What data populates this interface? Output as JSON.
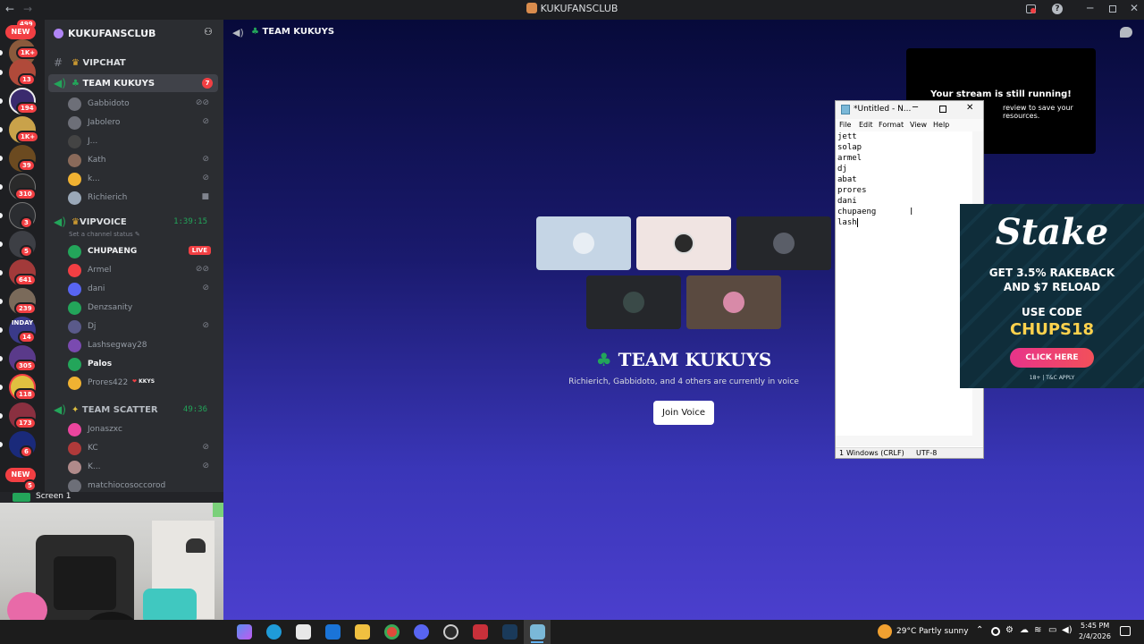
{
  "window": {
    "title": "KUKUFANSCLUB"
  },
  "rail": {
    "top_badge": "499",
    "badges": [
      "1K+",
      "13",
      "194",
      "1K+",
      "39",
      "310",
      "3",
      "5",
      "641",
      "239",
      "14",
      "305",
      "118",
      "173",
      "6",
      "5"
    ],
    "new_top": "NEW",
    "new_bottom": "NEW",
    "server_text": "INDAY"
  },
  "server": {
    "name": "KUKUFANSCLUB"
  },
  "channels": {
    "vipchat": "VIPCHAT",
    "team_kukuys": "TEAM KUKUYS",
    "team_kukuys_badge": "7",
    "team_kukuys_users": [
      "Gabbidoto",
      "Jabolero",
      "J...",
      "Kath",
      "k...",
      "Richierich"
    ],
    "vipvoice": "VIPVOICE",
    "vipvoice_timer": "1:39:15",
    "vipvoice_status": "Set a channel status",
    "vipvoice_users": [
      "CHUPAENG",
      "Armel",
      "dani",
      "Denzsanity",
      "Dj",
      "Lashsegway28",
      "Palos",
      "Prores422"
    ],
    "live_label": "LIVE",
    "prores_tag": "KKYS",
    "team_scatter": "TEAM SCATTER",
    "team_scatter_timer": "49:36",
    "team_scatter_users": [
      "Jonaszxc",
      "KC",
      "K...",
      "matchiocosoccorod"
    ]
  },
  "screen": {
    "label": "Screen 1"
  },
  "stage": {
    "header_title": "TEAM KUKUYS",
    "title": "TEAM KUKUYS",
    "subtitle": "Richierich, Gabbidoto, and 4 others are currently in voice",
    "join_label": "Join Voice"
  },
  "stream_card": {
    "title": "Your stream is still running!",
    "body": "review to save your resources."
  },
  "notepad": {
    "title": "*Untitled - N...",
    "menu": [
      "File",
      "Edit",
      "Format",
      "View",
      "Help"
    ],
    "lines": [
      "jett",
      "solap",
      "armel",
      "dj",
      "abat",
      "prores",
      "dani",
      "chupaeng",
      "lash"
    ],
    "status_line": "1",
    "status_eol": "Windows (CRLF)",
    "status_enc": "UTF-8"
  },
  "ad": {
    "brand": "Stake",
    "headline1": "GET 3.5% RAKEBACK",
    "headline2": "AND $7 RELOAD",
    "use_code": "USE CODE",
    "code": "CHUPS18",
    "cta": "CLICK HERE",
    "fine": "18+ | T&C APPLY"
  },
  "taskbar": {
    "weather": "29°C",
    "weather_desc": "Partly sunny",
    "time": "5:45 PM",
    "date": "2/4/2026"
  }
}
